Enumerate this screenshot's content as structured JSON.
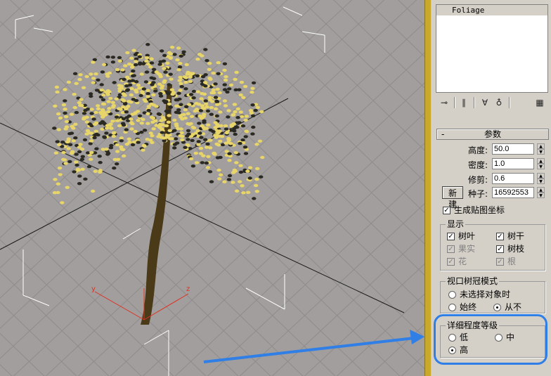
{
  "modifier_list": {
    "item": "Foliage"
  },
  "toolbar": {
    "buttons": [
      {
        "name": "pin-stack-icon",
        "glyph": "⊸"
      },
      {
        "name": "show-end-result-icon",
        "glyph": "∥"
      },
      {
        "name": "make-unique-icon",
        "glyph": "∀"
      },
      {
        "name": "remove-modifier-icon",
        "glyph": "♁"
      },
      {
        "name": "configure-sets-icon",
        "glyph": "▦"
      }
    ]
  },
  "params": {
    "rollout_minus": "-",
    "rollout_title": "参数",
    "height_label": "高度:",
    "height_value": "50.0",
    "density_label": "密度:",
    "density_value": "1.0",
    "prune_label": "修剪:",
    "prune_value": "0.6",
    "new_button": "新建",
    "seed_label": "种子:",
    "seed_value": "16592553",
    "gen_map_coords": "生成贴图坐标"
  },
  "display": {
    "title": "显示",
    "leaves": "树叶",
    "trunk": "树干",
    "fruit": "果实",
    "branches": "树枝",
    "flowers": "花",
    "roots": "根"
  },
  "canopy_mode": {
    "title": "视口树冠模式",
    "when_not_selected": "未选择对象时",
    "always": "始终",
    "never": "从不"
  },
  "lod": {
    "title": "详细程度等级",
    "low": "低",
    "medium": "中",
    "high": "高"
  },
  "viewport": {
    "gizmo_x": "x",
    "gizmo_y": "y",
    "gizmo_z": "z"
  },
  "colors": {
    "viewport_bg": "#a19e9d",
    "panel_bg": "#d4d0c8",
    "divider": "#c9a82a",
    "highlight": "#2f7fe6",
    "foliage": "#e8d56a",
    "trunk": "#4a3a18"
  }
}
